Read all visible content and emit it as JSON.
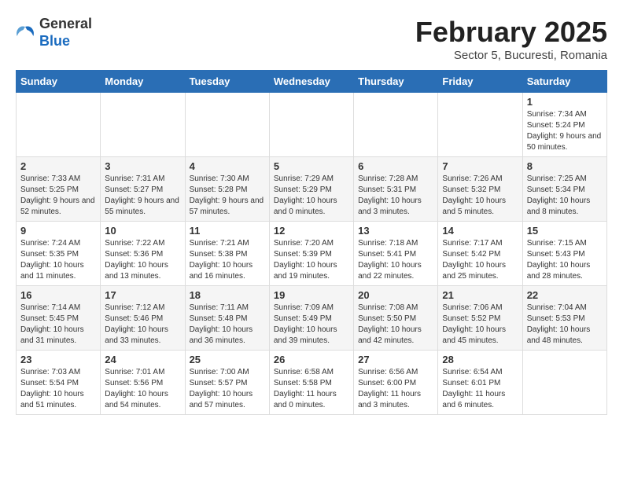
{
  "logo": {
    "general": "General",
    "blue": "Blue"
  },
  "title": "February 2025",
  "subtitle": "Sector 5, Bucuresti, Romania",
  "weekdays": [
    "Sunday",
    "Monday",
    "Tuesday",
    "Wednesday",
    "Thursday",
    "Friday",
    "Saturday"
  ],
  "weeks": [
    [
      null,
      null,
      null,
      null,
      null,
      null,
      {
        "day": "1",
        "detail": "Sunrise: 7:34 AM\nSunset: 5:24 PM\nDaylight: 9 hours and 50 minutes."
      }
    ],
    [
      {
        "day": "2",
        "detail": "Sunrise: 7:33 AM\nSunset: 5:25 PM\nDaylight: 9 hours and 52 minutes."
      },
      {
        "day": "3",
        "detail": "Sunrise: 7:31 AM\nSunset: 5:27 PM\nDaylight: 9 hours and 55 minutes."
      },
      {
        "day": "4",
        "detail": "Sunrise: 7:30 AM\nSunset: 5:28 PM\nDaylight: 9 hours and 57 minutes."
      },
      {
        "day": "5",
        "detail": "Sunrise: 7:29 AM\nSunset: 5:29 PM\nDaylight: 10 hours and 0 minutes."
      },
      {
        "day": "6",
        "detail": "Sunrise: 7:28 AM\nSunset: 5:31 PM\nDaylight: 10 hours and 3 minutes."
      },
      {
        "day": "7",
        "detail": "Sunrise: 7:26 AM\nSunset: 5:32 PM\nDaylight: 10 hours and 5 minutes."
      },
      {
        "day": "8",
        "detail": "Sunrise: 7:25 AM\nSunset: 5:34 PM\nDaylight: 10 hours and 8 minutes."
      }
    ],
    [
      {
        "day": "9",
        "detail": "Sunrise: 7:24 AM\nSunset: 5:35 PM\nDaylight: 10 hours and 11 minutes."
      },
      {
        "day": "10",
        "detail": "Sunrise: 7:22 AM\nSunset: 5:36 PM\nDaylight: 10 hours and 13 minutes."
      },
      {
        "day": "11",
        "detail": "Sunrise: 7:21 AM\nSunset: 5:38 PM\nDaylight: 10 hours and 16 minutes."
      },
      {
        "day": "12",
        "detail": "Sunrise: 7:20 AM\nSunset: 5:39 PM\nDaylight: 10 hours and 19 minutes."
      },
      {
        "day": "13",
        "detail": "Sunrise: 7:18 AM\nSunset: 5:41 PM\nDaylight: 10 hours and 22 minutes."
      },
      {
        "day": "14",
        "detail": "Sunrise: 7:17 AM\nSunset: 5:42 PM\nDaylight: 10 hours and 25 minutes."
      },
      {
        "day": "15",
        "detail": "Sunrise: 7:15 AM\nSunset: 5:43 PM\nDaylight: 10 hours and 28 minutes."
      }
    ],
    [
      {
        "day": "16",
        "detail": "Sunrise: 7:14 AM\nSunset: 5:45 PM\nDaylight: 10 hours and 31 minutes."
      },
      {
        "day": "17",
        "detail": "Sunrise: 7:12 AM\nSunset: 5:46 PM\nDaylight: 10 hours and 33 minutes."
      },
      {
        "day": "18",
        "detail": "Sunrise: 7:11 AM\nSunset: 5:48 PM\nDaylight: 10 hours and 36 minutes."
      },
      {
        "day": "19",
        "detail": "Sunrise: 7:09 AM\nSunset: 5:49 PM\nDaylight: 10 hours and 39 minutes."
      },
      {
        "day": "20",
        "detail": "Sunrise: 7:08 AM\nSunset: 5:50 PM\nDaylight: 10 hours and 42 minutes."
      },
      {
        "day": "21",
        "detail": "Sunrise: 7:06 AM\nSunset: 5:52 PM\nDaylight: 10 hours and 45 minutes."
      },
      {
        "day": "22",
        "detail": "Sunrise: 7:04 AM\nSunset: 5:53 PM\nDaylight: 10 hours and 48 minutes."
      }
    ],
    [
      {
        "day": "23",
        "detail": "Sunrise: 7:03 AM\nSunset: 5:54 PM\nDaylight: 10 hours and 51 minutes."
      },
      {
        "day": "24",
        "detail": "Sunrise: 7:01 AM\nSunset: 5:56 PM\nDaylight: 10 hours and 54 minutes."
      },
      {
        "day": "25",
        "detail": "Sunrise: 7:00 AM\nSunset: 5:57 PM\nDaylight: 10 hours and 57 minutes."
      },
      {
        "day": "26",
        "detail": "Sunrise: 6:58 AM\nSunset: 5:58 PM\nDaylight: 11 hours and 0 minutes."
      },
      {
        "day": "27",
        "detail": "Sunrise: 6:56 AM\nSunset: 6:00 PM\nDaylight: 11 hours and 3 minutes."
      },
      {
        "day": "28",
        "detail": "Sunrise: 6:54 AM\nSunset: 6:01 PM\nDaylight: 11 hours and 6 minutes."
      },
      null
    ]
  ]
}
